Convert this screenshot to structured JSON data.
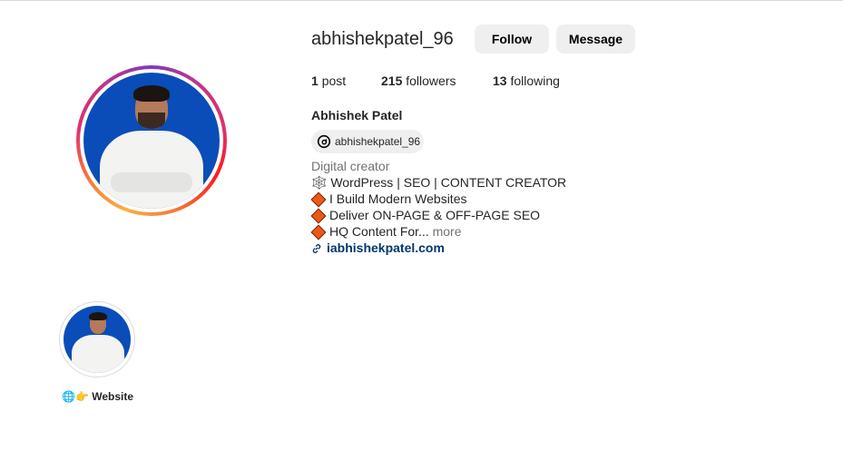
{
  "profile": {
    "username": "abhishekpatel_96",
    "follow_label": "Follow",
    "message_label": "Message",
    "stats": {
      "posts_count": "1",
      "posts_label": "post",
      "followers_count": "215",
      "followers_label": "followers",
      "following_count": "13",
      "following_label": "following"
    },
    "full_name": "Abhishek Patel",
    "threads_handle": "abhishekpatel_96",
    "category": "Digital creator",
    "bio": {
      "line1_emoji": "🕸️",
      "line1": "WordPress | SEO | CONTENT CREATOR",
      "line2": "I Build Modern Websites",
      "line3": "Deliver ON-PAGE & OFF-PAGE SEO",
      "line4": "HQ Content For...",
      "more_label": "more"
    },
    "website_link": "iabhishekpatel.com"
  },
  "highlights": [
    {
      "emoji": "🌐👉",
      "label": "Website"
    }
  ],
  "icons": {
    "threads": "threads-icon",
    "link": "link-icon",
    "bullet": "orange-diamond-icon"
  },
  "colors": {
    "button_bg": "#efefef",
    "link": "#00376b",
    "muted": "#737373",
    "photo_bg": "#0a4db8",
    "diamond": "#e8591a"
  }
}
